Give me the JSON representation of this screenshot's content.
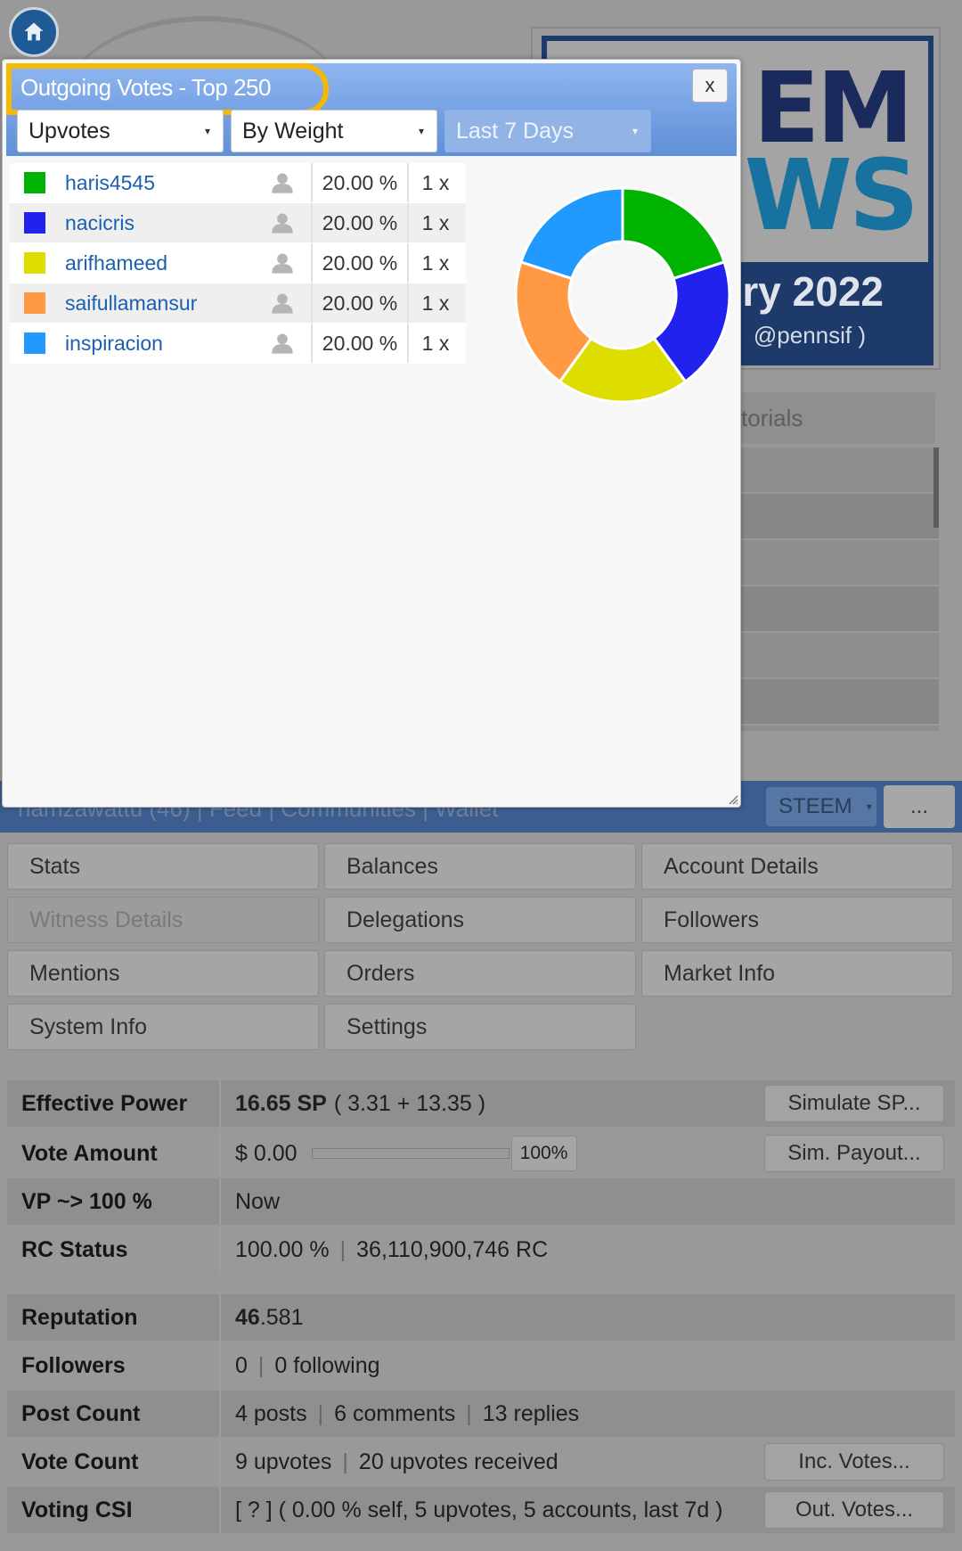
{
  "background": {
    "banner_big_top": "EM",
    "banner_big_bottom": "WS",
    "banner_date": "ry 2022",
    "banner_author": "@pennsif )",
    "side_tab": "torials",
    "nav_ghost": "hamzawattu (46)   |   Feed   |   Communities   |   Wallet",
    "network_select": "STEEM",
    "more_button": "...",
    "tabs": [
      {
        "label": "Stats",
        "state": "active"
      },
      {
        "label": "Balances",
        "state": "normal"
      },
      {
        "label": "Account Details",
        "state": "normal"
      },
      {
        "label": "Witness Details",
        "state": "disabled"
      },
      {
        "label": "Delegations",
        "state": "normal"
      },
      {
        "label": "Followers",
        "state": "normal"
      },
      {
        "label": "Mentions",
        "state": "normal"
      },
      {
        "label": "Orders",
        "state": "normal"
      },
      {
        "label": "Market Info",
        "state": "normal"
      },
      {
        "label": "System Info",
        "state": "normal"
      },
      {
        "label": "Settings",
        "state": "normal"
      }
    ],
    "stats": {
      "effective_power_label": "Effective Power",
      "effective_power_value": "16.65 SP",
      "effective_power_detail": "( 3.31 + 13.35 )",
      "simulate_sp_button": "Simulate SP...",
      "vote_amount_label": "Vote Amount",
      "vote_amount_value": "$ 0.00",
      "vote_weight": "100%",
      "sim_payout_button": "Sim. Payout...",
      "vp_label": "VP ~> 100 %",
      "vp_value": "Now",
      "rc_label": "RC Status",
      "rc_percent": "100.00 %",
      "rc_value": "36,110,900,746 RC",
      "reputation_label": "Reputation",
      "reputation_int": "46",
      "reputation_dec": ".581",
      "followers_label": "Followers",
      "followers_count": "0",
      "following_count": "0 following",
      "post_count_label": "Post Count",
      "posts": "4 posts",
      "comments": "6 comments",
      "replies": "13 replies",
      "vote_count_label": "Vote Count",
      "upvotes": "9 upvotes",
      "upvotes_received": "20 upvotes received",
      "inc_votes_button": "Inc. Votes...",
      "voting_csi_label": "Voting CSI",
      "voting_csi_value": "[ ? ] ( 0.00 % self, 5 upvotes, 5 accounts, last 7d )",
      "out_votes_button": "Out. Votes..."
    }
  },
  "modal": {
    "title": "Outgoing Votes - Top 250",
    "close_label": "x",
    "filter_type": "Upvotes",
    "sort_by": "By Weight",
    "period": "Last 7 Days",
    "votes": [
      {
        "account": "haris4545",
        "weight": "20.00 %",
        "count": "1 x",
        "color": "#00b300"
      },
      {
        "account": "nacicris",
        "weight": "20.00 %",
        "count": "1 x",
        "color": "#2222ee"
      },
      {
        "account": "arifhameed",
        "weight": "20.00 %",
        "count": "1 x",
        "color": "#dddd00"
      },
      {
        "account": "saifullamansur",
        "weight": "20.00 %",
        "count": "1 x",
        "color": "#ff9944"
      },
      {
        "account": "inspiracion",
        "weight": "20.00 %",
        "count": "1 x",
        "color": "#2299ff"
      }
    ]
  },
  "chart_data": {
    "type": "pie",
    "categories": [
      "haris4545",
      "nacicris",
      "arifhameed",
      "saifullamansur",
      "inspiracion"
    ],
    "values": [
      20,
      20,
      20,
      20,
      20
    ],
    "colors": [
      "#00b300",
      "#2222ee",
      "#dddd00",
      "#ff9944",
      "#2299ff"
    ],
    "title": ""
  }
}
